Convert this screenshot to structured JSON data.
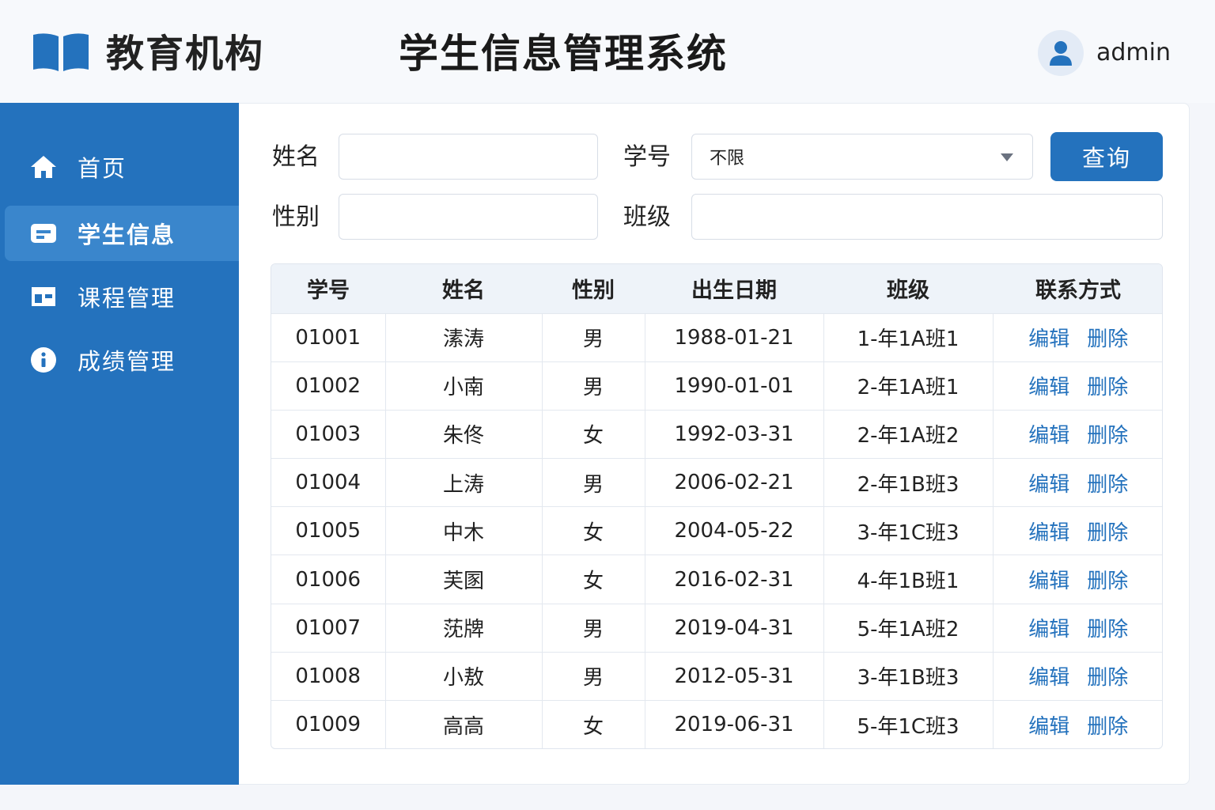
{
  "header": {
    "org_name": "教育机构",
    "app_title": "学生信息管理系统",
    "user_name": "admin"
  },
  "sidebar": {
    "items": [
      {
        "label": "首页",
        "icon": "home-icon"
      },
      {
        "label": "学生信息",
        "icon": "id-card-icon",
        "active": true
      },
      {
        "label": "课程管理",
        "icon": "grid-icon"
      },
      {
        "label": "成绩管理",
        "icon": "info-icon"
      }
    ]
  },
  "filters": {
    "name_label": "姓名",
    "name_value": "",
    "id_label": "学号",
    "id_selected": "不限",
    "gender_label": "性别",
    "gender_value": "",
    "class_label": "班级",
    "class_value": "",
    "query_label": "查询"
  },
  "table": {
    "columns": [
      "学号",
      "姓名",
      "性别",
      "出生日期",
      "班级",
      "联系方式"
    ],
    "edit_label": "编辑",
    "delete_label": "删除",
    "rows": [
      [
        "01001",
        "溸涛",
        "男",
        "1988-01-21",
        "1-年1A班1"
      ],
      [
        "01002",
        "小南",
        "男",
        "1990-01-01",
        "2-年1A班1"
      ],
      [
        "01003",
        "朱佟",
        "女",
        "1992-03-31",
        "2-年1A班2"
      ],
      [
        "01004",
        "上涛",
        "男",
        "2006-02-21",
        "2-年1B班3"
      ],
      [
        "01005",
        "中木",
        "女",
        "2004-05-22",
        "3-年1C班3"
      ],
      [
        "01006",
        "芙圂",
        "女",
        "2016-02-31",
        "4-年1B班1"
      ],
      [
        "01007",
        "莐牌",
        "男",
        "2019-04-31",
        "5-年1A班2"
      ],
      [
        "01008",
        "小敖",
        "男",
        "2012-05-31",
        "3-年1B班3"
      ],
      [
        "01009",
        "高高",
        "女",
        "2019-06-31",
        "5-年1C班3"
      ]
    ]
  },
  "colors": {
    "primary": "#2472bd",
    "sidebar_active": "#3a86cc",
    "header_bg": "#f7f9fc"
  }
}
